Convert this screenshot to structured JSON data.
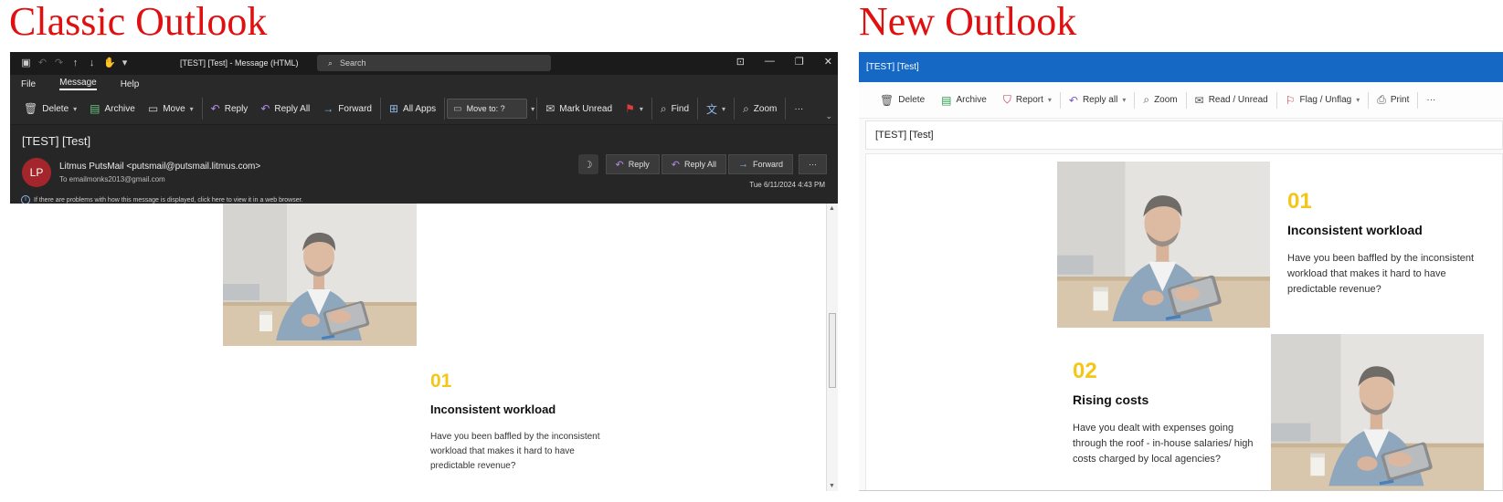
{
  "titles": {
    "left": "Classic Outlook",
    "right": "New Outlook"
  },
  "classic": {
    "window_title": "[TEST] [Test]  -  Message (HTML)",
    "search_placeholder": "Search",
    "menu": [
      "File",
      "Message",
      "Help"
    ],
    "ribbon": {
      "delete": "Delete",
      "archive": "Archive",
      "move": "Move",
      "reply": "Reply",
      "reply_all": "Reply All",
      "forward": "Forward",
      "all_apps": "All Apps",
      "move_to": "Move to: ?",
      "mark_unread": "Mark Unread",
      "find": "Find",
      "zoom": "Zoom"
    },
    "subject": "[TEST] [Test]",
    "avatar_initials": "LP",
    "from": "Litmus PutsMail <putsmail@putsmail.litmus.com>",
    "to": "To   emailmonks2013@gmail.com",
    "info_bar": "If there are problems with how this message is displayed, click here to view it in a web browser.",
    "actions": {
      "reply": "Reply",
      "reply_all": "Reply All",
      "forward": "Forward"
    },
    "date": "Tue 6/11/2024 4:43 PM",
    "item": {
      "number": "01",
      "heading": "Inconsistent workload",
      "text": "Have you been baffled by the inconsistent workload that makes it hard to have predictable revenue?"
    }
  },
  "new": {
    "window_title": "[TEST] [Test]",
    "toolbar": {
      "delete": "Delete",
      "archive": "Archive",
      "report": "Report",
      "reply_all": "Reply all",
      "zoom": "Zoom",
      "read_unread": "Read / Unread",
      "flag_unflag": "Flag / Unflag",
      "print": "Print"
    },
    "subject": "[TEST] [Test]",
    "items": [
      {
        "number": "01",
        "heading": "Inconsistent workload",
        "text": "Have you been baffled by the inconsistent workload that makes it hard to have predictable revenue?"
      },
      {
        "number": "02",
        "heading": "Rising costs",
        "text": "Have you dealt with expenses going through the roof - in-house salaries/ high costs charged by local agencies?"
      }
    ]
  }
}
